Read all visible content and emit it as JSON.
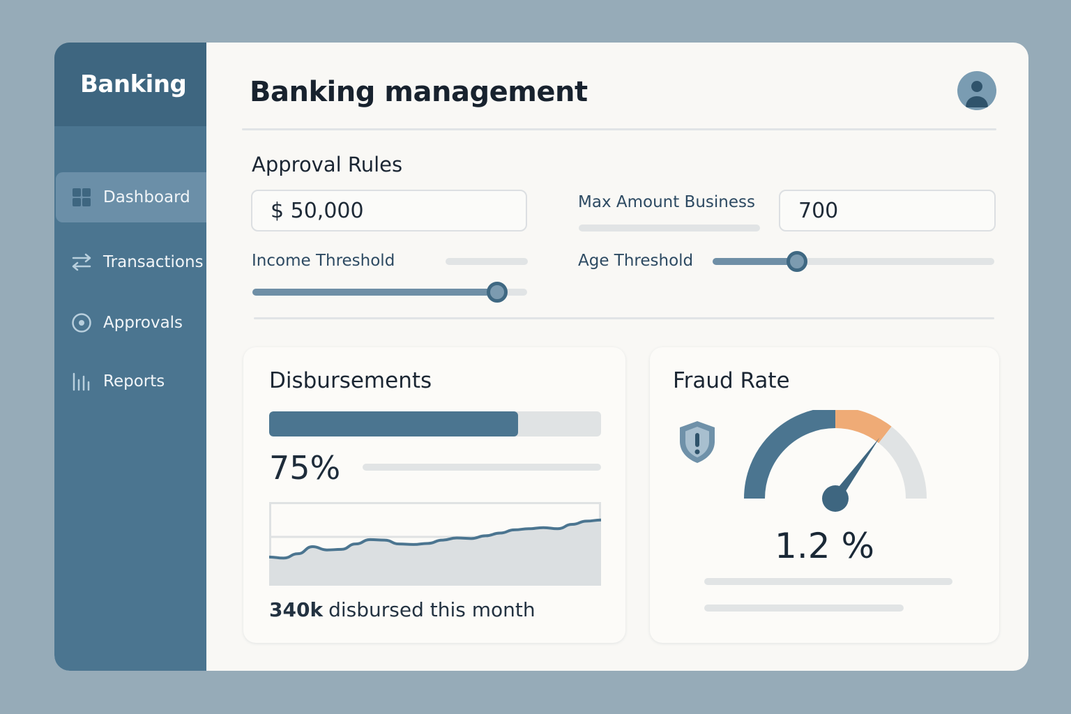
{
  "sidebar": {
    "brand": "Banking",
    "items": [
      {
        "label": "Dashboard",
        "icon": "grid-icon",
        "active": true
      },
      {
        "label": "Transactions",
        "icon": "transfer-arrows-icon",
        "active": false
      },
      {
        "label": "Approvals",
        "icon": "target-icon",
        "active": false
      },
      {
        "label": "Reports",
        "icon": "bar-chart-icon",
        "active": false
      }
    ]
  },
  "header": {
    "title": "Banking management",
    "avatar_icon": "user-avatar-icon"
  },
  "approval_rules": {
    "title": "Approval Rules",
    "amount_value": "$  50,000",
    "max_amount_label": "Max Amount Business",
    "max_amount_value": "700",
    "income_threshold": {
      "label": "Income Threshold",
      "value_fraction": 0.89
    },
    "age_threshold": {
      "label": "Age Threshold",
      "value_fraction": 0.3
    }
  },
  "disbursements": {
    "title": "Disbursements",
    "progress_fraction": 0.75,
    "percent_label": "75%",
    "trend": [
      22,
      20,
      28,
      41,
      35,
      36,
      46,
      54,
      53,
      46,
      45,
      47,
      53,
      57,
      56,
      61,
      66,
      72,
      74,
      76,
      74,
      82,
      88,
      90
    ],
    "amount": "340k",
    "caption": "disbursed this month"
  },
  "fraud_rate": {
    "title": "Fraud Rate",
    "value": "1.2 %",
    "icon": "shield-alert-icon",
    "needle_fraction": 0.7,
    "colors": {
      "low": "#4b7590",
      "mid": "#efab76",
      "high": "#e0e3e4"
    }
  }
}
